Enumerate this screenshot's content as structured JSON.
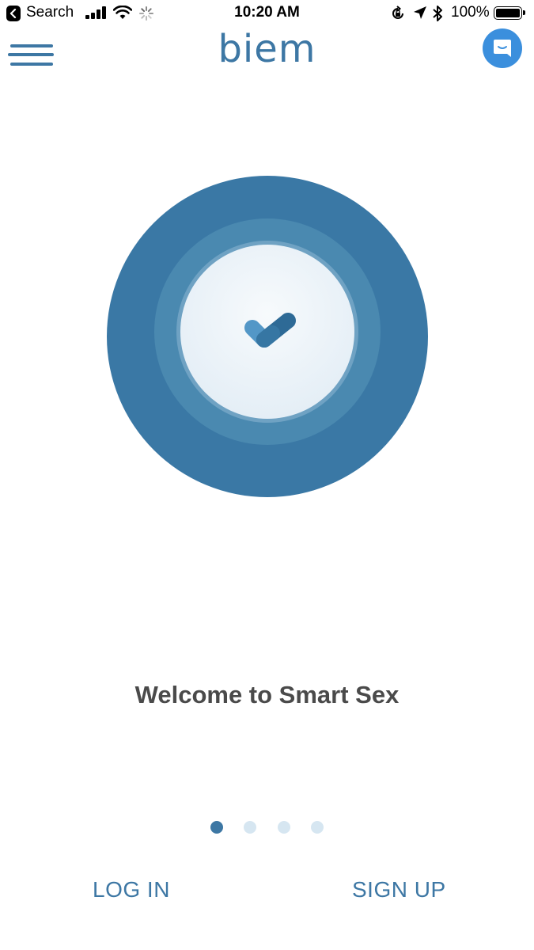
{
  "status_bar": {
    "back_label": "Search",
    "time": "10:20 AM",
    "battery_percent": "100%",
    "icons": [
      "back-arrow-icon",
      "signal-bars-icon",
      "wifi-icon",
      "loading-spinner-icon",
      "orientation-lock-icon",
      "location-arrow-icon",
      "bluetooth-icon",
      "battery-icon"
    ]
  },
  "header": {
    "menu_icon": "hamburger-menu-icon",
    "logo_text": "biem",
    "chat_icon": "chat-bubble-icon"
  },
  "illustration": {
    "icon": "checkmark-icon"
  },
  "main": {
    "welcome_text": "Welcome to Smart Sex"
  },
  "pager": {
    "total": 4,
    "active_index": 0
  },
  "actions": {
    "login_label": "LOG IN",
    "signup_label": "SIGN UP"
  },
  "colors": {
    "brand": "#3d77a4",
    "chat_button": "#3b8fdd",
    "text": "#4a4a4a",
    "dot_inactive": "#d6e6f1"
  }
}
